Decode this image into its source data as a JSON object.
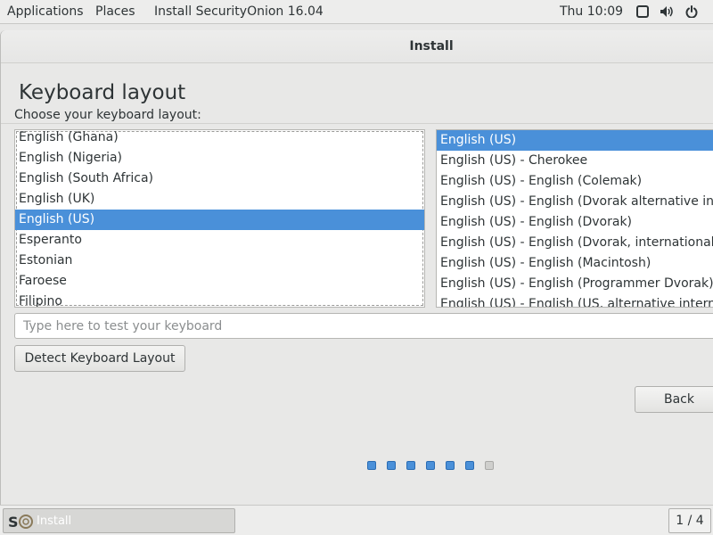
{
  "topbar": {
    "applications": "Applications",
    "places": "Places",
    "app_name": "Install SecurityOnion 16.04",
    "clock": "Thu 10:09",
    "tray_icons": [
      "window-icon",
      "volume-icon",
      "power-icon"
    ]
  },
  "window": {
    "title": "Install",
    "heading": "Keyboard layout",
    "prompt": "Choose your keyboard layout:"
  },
  "layouts": {
    "items": [
      "English (Ghana)",
      "English (Nigeria)",
      "English (South Africa)",
      "English (UK)",
      "English (US)",
      "Esperanto",
      "Estonian",
      "Faroese",
      "Filipino"
    ],
    "selected": "English (US)"
  },
  "variants": {
    "items": [
      "English (US)",
      "English (US) - Cherokee",
      "English (US) - English (Colemak)",
      "English (US) - English (Dvorak alternative international no dead keys)",
      "English (US) - English (Dvorak)",
      "English (US) - English (Dvorak, international with dead keys)",
      "English (US) - English (Macintosh)",
      "English (US) - English (Programmer Dvorak)",
      "English (US) - English (US, alternative international)"
    ],
    "selected": "English (US)"
  },
  "test_input": {
    "placeholder": "Type here to test your keyboard",
    "value": ""
  },
  "buttons": {
    "detect": "Detect Keyboard Layout",
    "back": "Back"
  },
  "progress": {
    "total_steps": 6,
    "completed_steps": 5
  },
  "taskbar": {
    "task_label": "Install",
    "logo_text": "S",
    "pager": "1 / 4"
  },
  "colors": {
    "selection": "#4a90d9",
    "panel": "#ededec",
    "window_bg": "#e8e8e7"
  }
}
